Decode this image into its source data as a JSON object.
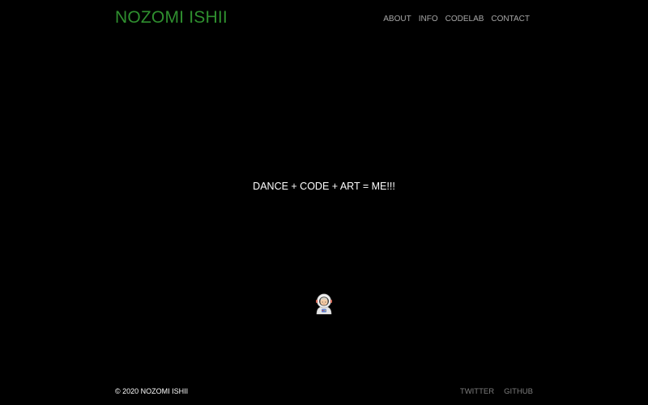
{
  "header": {
    "site_title": "NOZOMI ISHII",
    "nav": [
      {
        "label": "ABOUT"
      },
      {
        "label": "INFO"
      },
      {
        "label": "CODELAB"
      },
      {
        "label": "CONTACT"
      }
    ]
  },
  "main": {
    "tagline": "DANCE + CODE + ART = ME!!!",
    "emoji_icon": "astronaut-icon"
  },
  "footer": {
    "copyright": "© 2020 NOZOMI ISHII",
    "links": [
      {
        "label": "TWITTER"
      },
      {
        "label": "GITHUB"
      }
    ]
  },
  "colors": {
    "background": "#000000",
    "title": "#2f8f2f",
    "nav_text": "#a7a7a7",
    "body_text": "#ffffff",
    "footer_link": "#7d7d7d"
  }
}
